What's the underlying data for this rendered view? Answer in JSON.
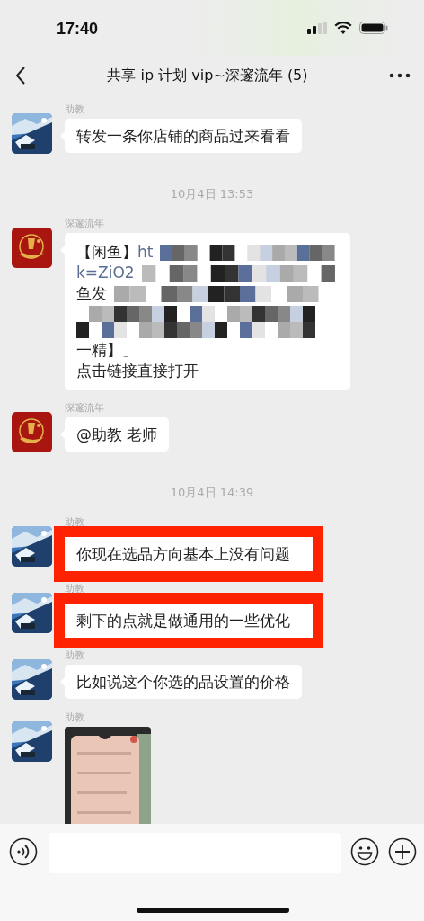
{
  "status_bar": {
    "time": "17:40"
  },
  "header": {
    "title": "共享 ip 计划 vip~深邃流年 (5)"
  },
  "messages": [
    {
      "kind": "text",
      "sender": "助教",
      "text": "转发一条你店铺的商品过来看看",
      "highlighted": false
    },
    {
      "kind": "time",
      "text": "10月4日 13:53"
    },
    {
      "kind": "link",
      "sender": "深邃流年",
      "avatar": {
        "kind": "emblem"
      },
      "lines": [
        {
          "kind": "text",
          "redacted_tail": true,
          "segments": [
            {
              "kind": "plain",
              "text": "【闲鱼】"
            },
            {
              "kind": "link",
              "text": "ht"
            }
          ]
        },
        {
          "kind": "text",
          "redacted_tail": true,
          "segments": [
            {
              "kind": "link",
              "text": "k=ZiO2"
            }
          ]
        },
        {
          "kind": "text",
          "redacted_tail": true,
          "segments": [
            {
              "kind": "plain",
              "text": "鱼发"
            }
          ]
        },
        {
          "kind": "redacted"
        },
        {
          "kind": "text",
          "redacted_tail": false,
          "segments": [
            {
              "kind": "plain",
              "text": "一精】」"
            }
          ]
        },
        {
          "kind": "text",
          "redacted_tail": false,
          "segments": [
            {
              "kind": "plain",
              "text": "点击链接直接打开"
            }
          ]
        }
      ]
    },
    {
      "kind": "text",
      "sender": "深邃流年",
      "avatar": {
        "kind": "emblem"
      },
      "text": "@助教 老师",
      "highlighted": false
    },
    {
      "kind": "time",
      "text": "10月4日 14:39"
    },
    {
      "kind": "text",
      "sender": "助教",
      "text": "你现在选品方向基本上没有问题",
      "highlighted": true
    },
    {
      "kind": "text",
      "sender": "助教",
      "text": "剩下的点就是做通用的一些优化",
      "highlighted": true
    },
    {
      "kind": "text",
      "sender": "助教",
      "text": "比如说这个你选的品设置的价格",
      "highlighted": false
    },
    {
      "sender": "助教"
    }
  ]
}
